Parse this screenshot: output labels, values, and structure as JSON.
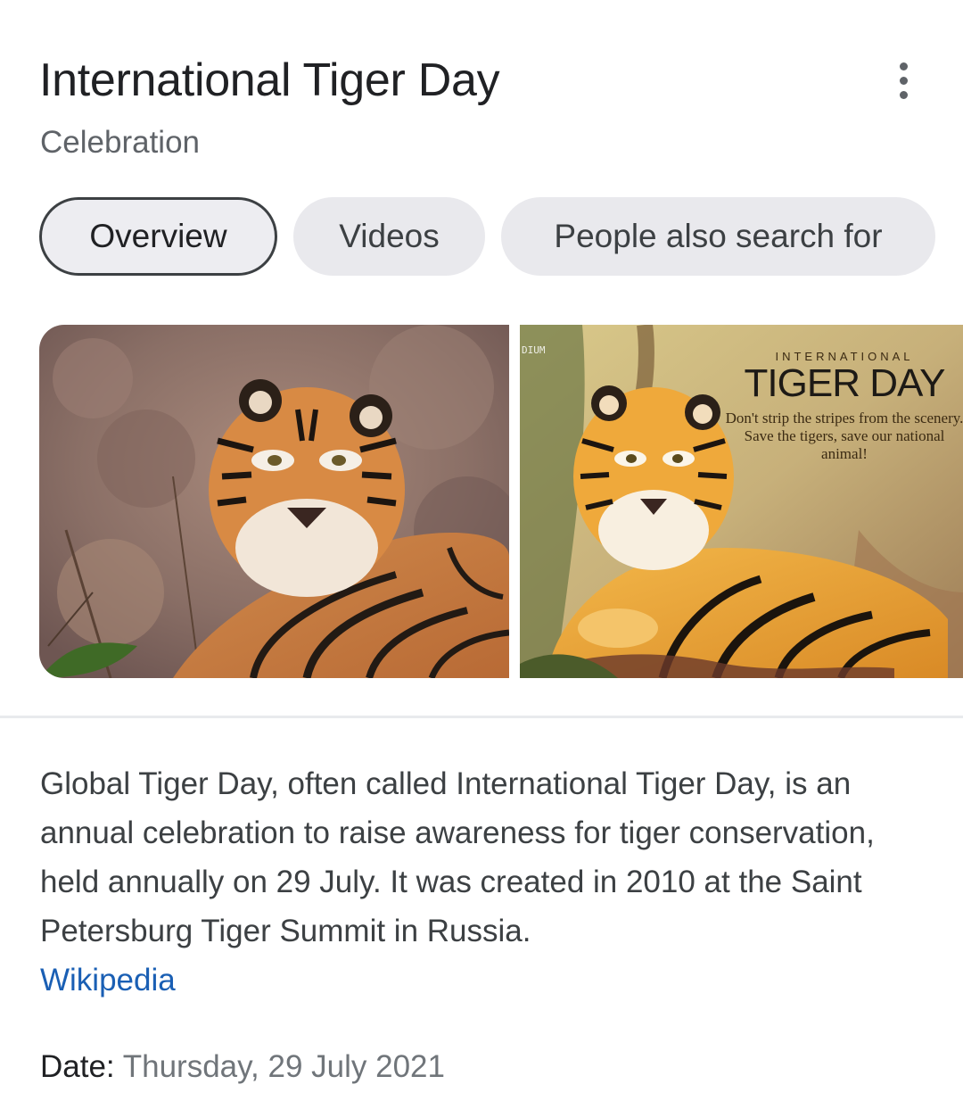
{
  "header": {
    "title": "International Tiger Day",
    "subtitle": "Celebration",
    "menu_icon": "more-vert-icon"
  },
  "tabs": [
    {
      "label": "Overview",
      "selected": true
    },
    {
      "label": "Videos",
      "selected": false
    },
    {
      "label": "People also search for",
      "selected": false
    }
  ],
  "images": {
    "poster": {
      "corner_text": "DIUM",
      "small_title": "INTERNATIONAL",
      "big_title": "TIGER DAY",
      "tagline": "Don't strip the stripes from the scenery. Save the tigers, save our national animal!"
    }
  },
  "description": {
    "text": "Global Tiger Day, often called International Tiger Day, is an annual celebration to raise awareness for tiger conservation, held annually on 29 July. It was created in 2010 at the Saint Petersburg Tiger Summit in Russia.",
    "source": "Wikipedia"
  },
  "facts": {
    "date_label": "Date:",
    "date_value": "Thursday, 29 July 2021"
  },
  "colors": {
    "link": "#1a5fb4",
    "chip_bg": "#e9e9ed",
    "chip_selected_border": "#3c4043"
  }
}
